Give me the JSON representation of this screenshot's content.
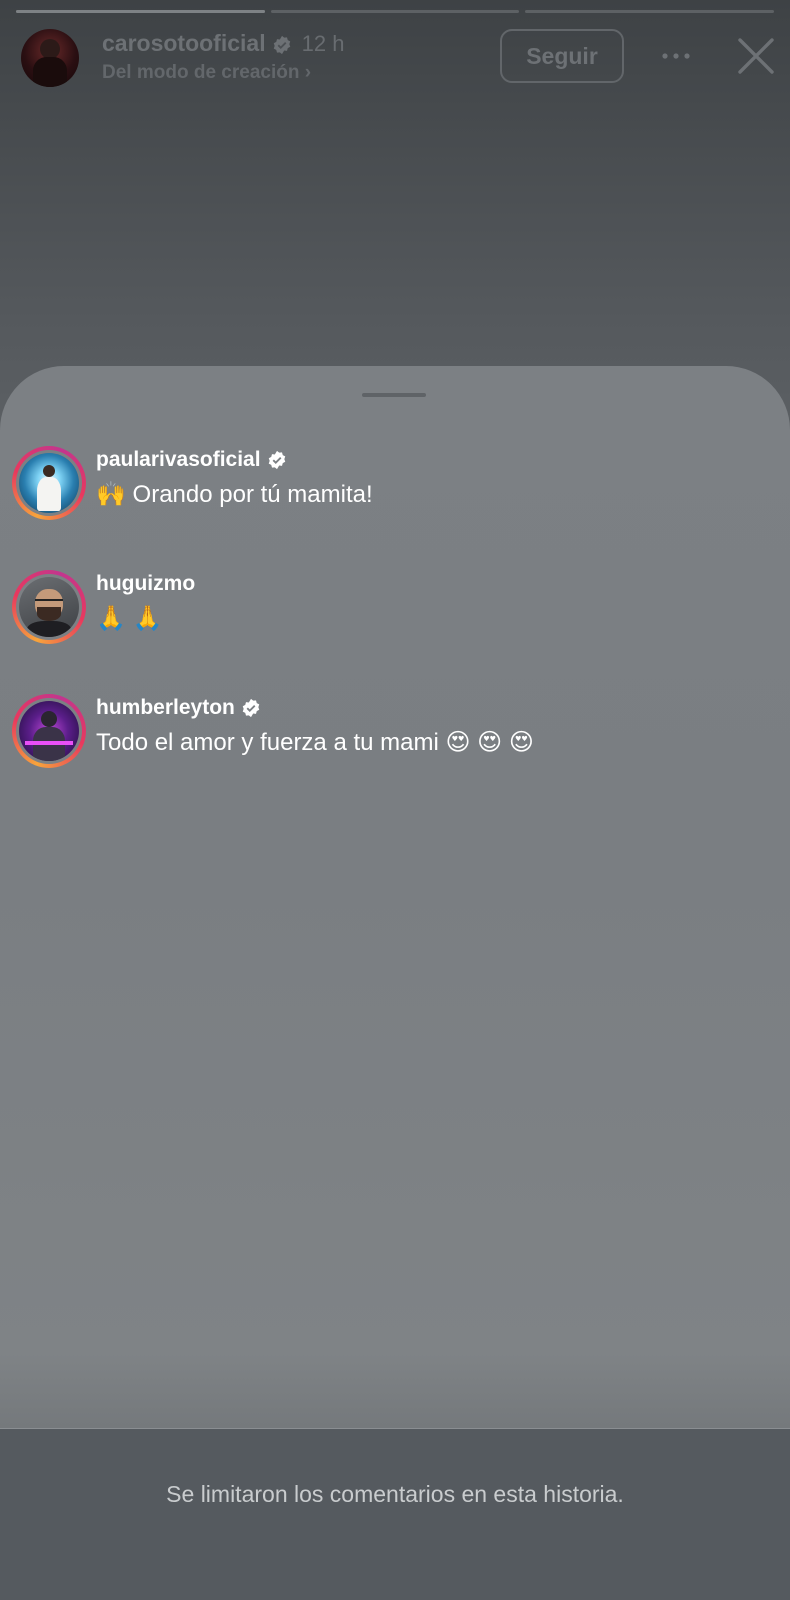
{
  "story": {
    "progress": [
      1,
      0,
      0
    ],
    "username": "carosotooficial",
    "time": "12 h",
    "subtitle": "Del modo de creación ›",
    "follow_label": "Seguir"
  },
  "comments": [
    {
      "username": "paularivasoficial",
      "verified": true,
      "text": "🙌 Orando por tú mamita!"
    },
    {
      "username": "huguizmo",
      "verified": false,
      "text": "🙏 🙏"
    },
    {
      "username": "humberleyton",
      "verified": true,
      "text": "Todo el amor y fuerza a tu mami 😍 😍 😍"
    }
  ],
  "footer": {
    "notice": "Se limitaron los comentarios en esta historia."
  },
  "colors": {
    "accent_ring_start": "#f7a43b",
    "accent_ring_mid": "#e8385e",
    "accent_ring_end": "#c2358f"
  },
  "icons": [
    "verified-badge-icon",
    "more-options-icon",
    "close-icon"
  ]
}
